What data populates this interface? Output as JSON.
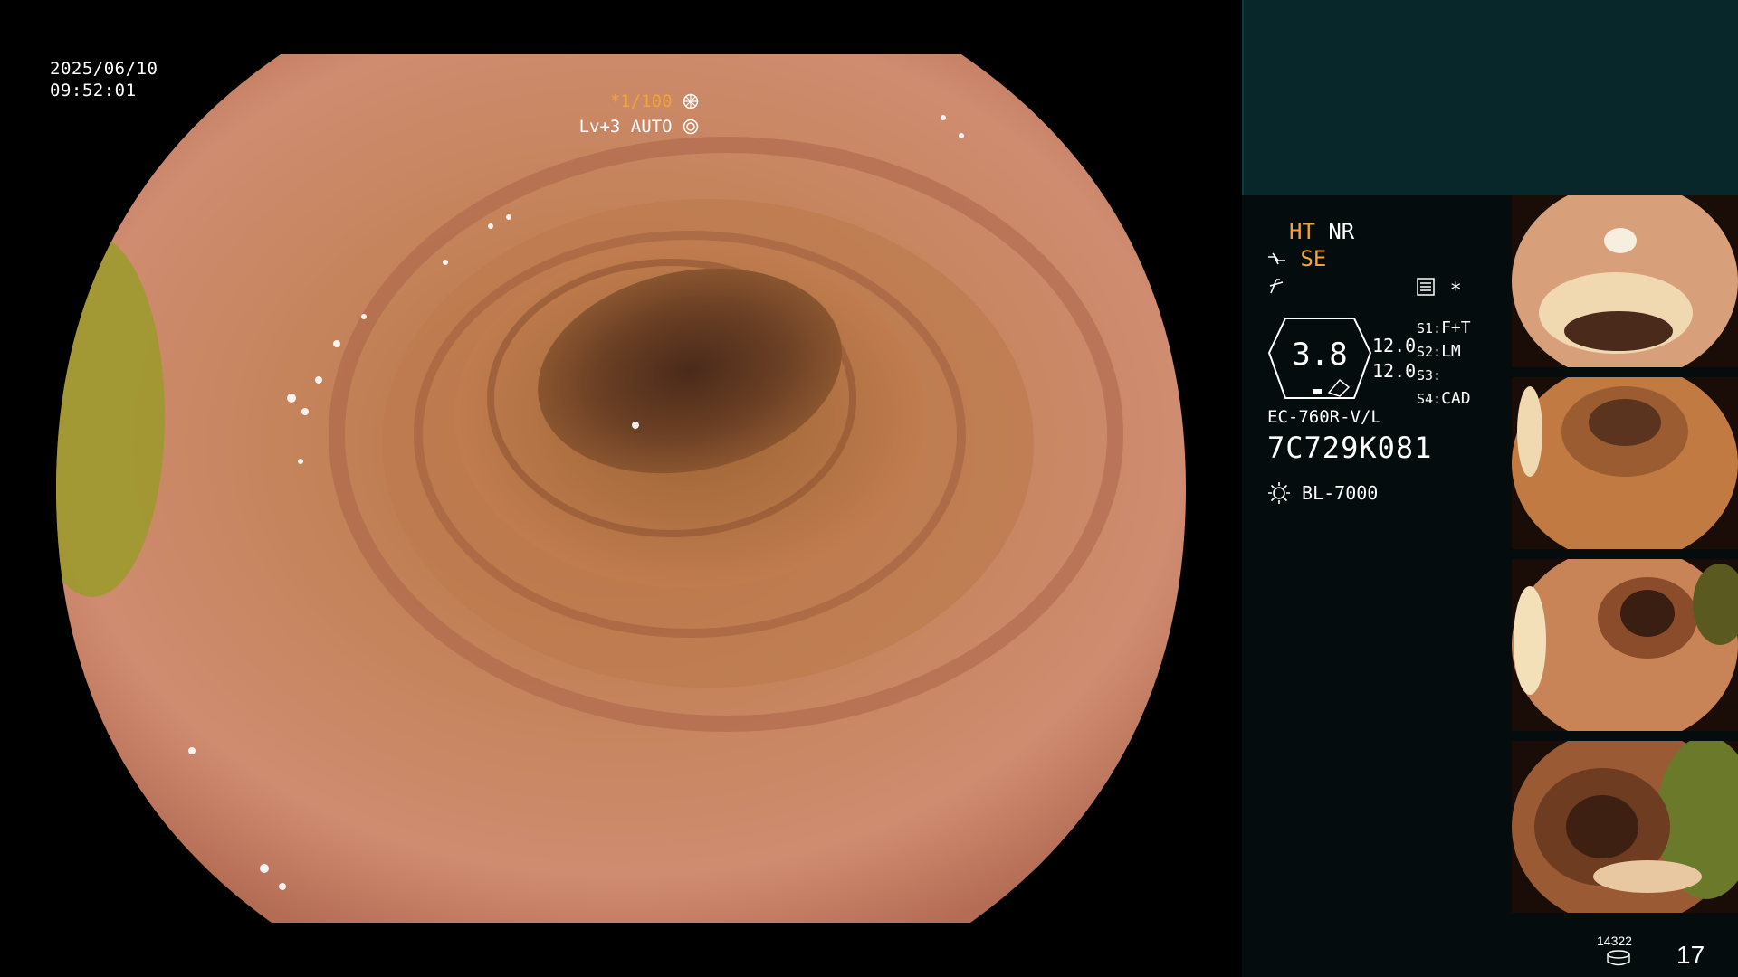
{
  "osd": {
    "date": "2025/06/10",
    "time": "09:52:01",
    "shutter": "*1/100",
    "level": "Lv+3",
    "iris": "AUTO"
  },
  "settings": {
    "ht": "HT",
    "nr": "NR",
    "se": "SE",
    "zoom": "3.8",
    "val1": "12.0",
    "val2": "12.0",
    "star": "*",
    "s1_label": "S1:",
    "s1_val": "F+T",
    "s2_label": "S2:",
    "s2_val": "LM",
    "s3_label": "S3:",
    "s3_val": "",
    "s4_label": "S4:",
    "s4_val": "CAD",
    "scope_model": "EC-760R-V/L",
    "scope_serial": "7C729K081",
    "light_source": "BL-7000"
  },
  "storage": {
    "remaining": "14322",
    "count": "17"
  },
  "colors": {
    "accent_orange": "#f0a43a",
    "panel_top": "#07272a",
    "panel_bg": "#050c0d"
  },
  "icons": [
    "shutter-icon",
    "iris-icon",
    "structure-enhancement-icon",
    "color-mode-icon",
    "settings-icon",
    "light-source-icon",
    "storage-disk-icon"
  ]
}
